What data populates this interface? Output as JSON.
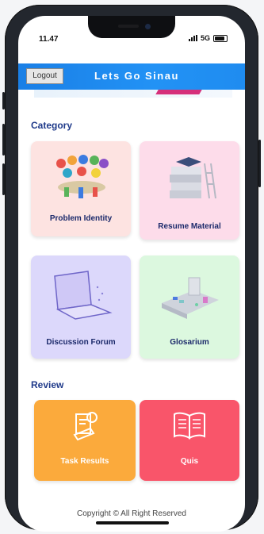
{
  "status_bar": {
    "time": "11.47",
    "network": "5G"
  },
  "app_bar": {
    "logout_label": "Logout",
    "title": "Lets Go Sinau"
  },
  "category": {
    "title": "Category",
    "items": [
      {
        "label": "Problem Identity",
        "bg": "#fde3e1"
      },
      {
        "label": "Resume Material",
        "bg": "#fddcea"
      },
      {
        "label": "Discussion Forum",
        "bg": "#dcd8fb"
      },
      {
        "label": "Glosarium",
        "bg": "#dcf8df"
      }
    ]
  },
  "review": {
    "title": "Review",
    "items": [
      {
        "label": "Task Results",
        "bg": "#fbaa3c",
        "icon": "certificate-icon"
      },
      {
        "label": "Quis",
        "bg": "#f9556a",
        "icon": "book-icon"
      }
    ]
  },
  "footer": {
    "copyright": "Copyright © All Right Reserved"
  }
}
